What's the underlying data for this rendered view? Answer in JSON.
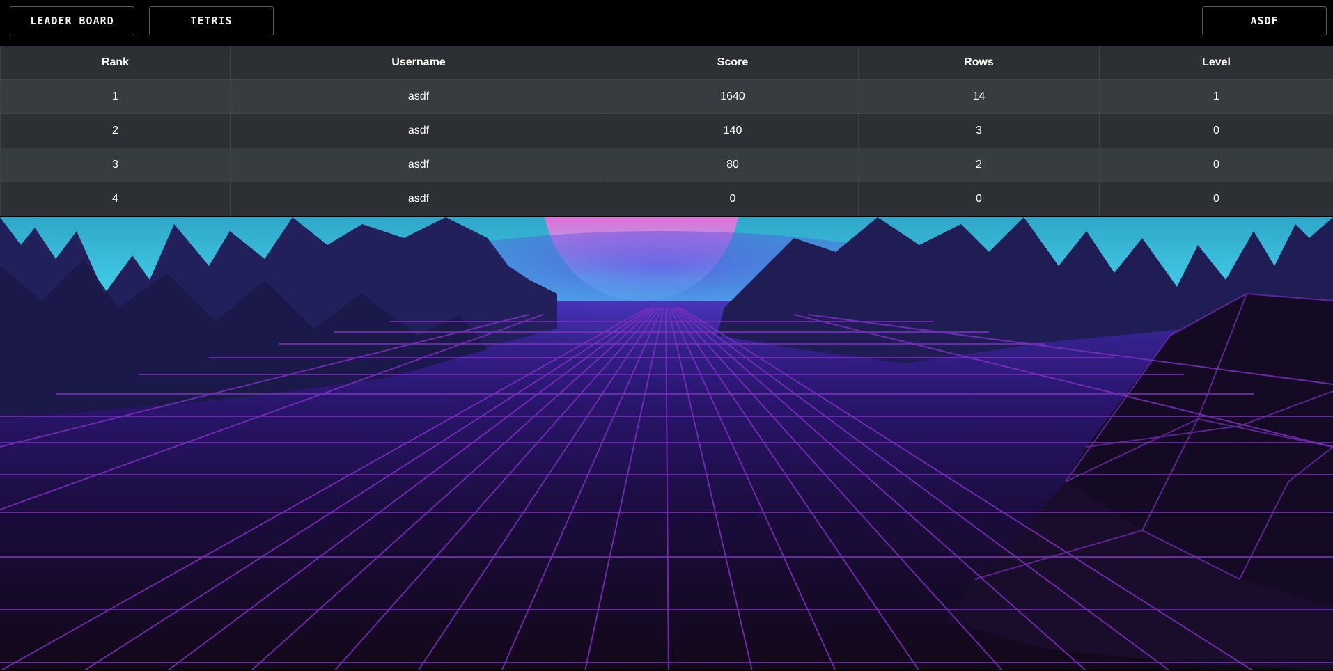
{
  "nav": {
    "leaderboard_label": "LEADER BOARD",
    "tetris_label": "TETRIS",
    "user_label": "ASDF"
  },
  "table": {
    "columns": [
      "Rank",
      "Username",
      "Score",
      "Rows",
      "Level"
    ],
    "rows": [
      {
        "rank": "1",
        "username": "asdf",
        "score": "1640",
        "rows": "14",
        "level": "1"
      },
      {
        "rank": "2",
        "username": "asdf",
        "score": "140",
        "rows": "3",
        "level": "0"
      },
      {
        "rank": "3",
        "username": "asdf",
        "score": "80",
        "rows": "2",
        "level": "0"
      },
      {
        "rank": "4",
        "username": "asdf",
        "score": "0",
        "rows": "0",
        "level": "0"
      }
    ]
  },
  "colors": {
    "topbar": "#000000",
    "header_bg": "#2c3034",
    "row_odd": "#373c40",
    "row_even": "#2c3034",
    "grid_purple": "#7b2fbf",
    "sky_cyan": "#4fe0f5",
    "sun_pink": "#e67be6"
  }
}
